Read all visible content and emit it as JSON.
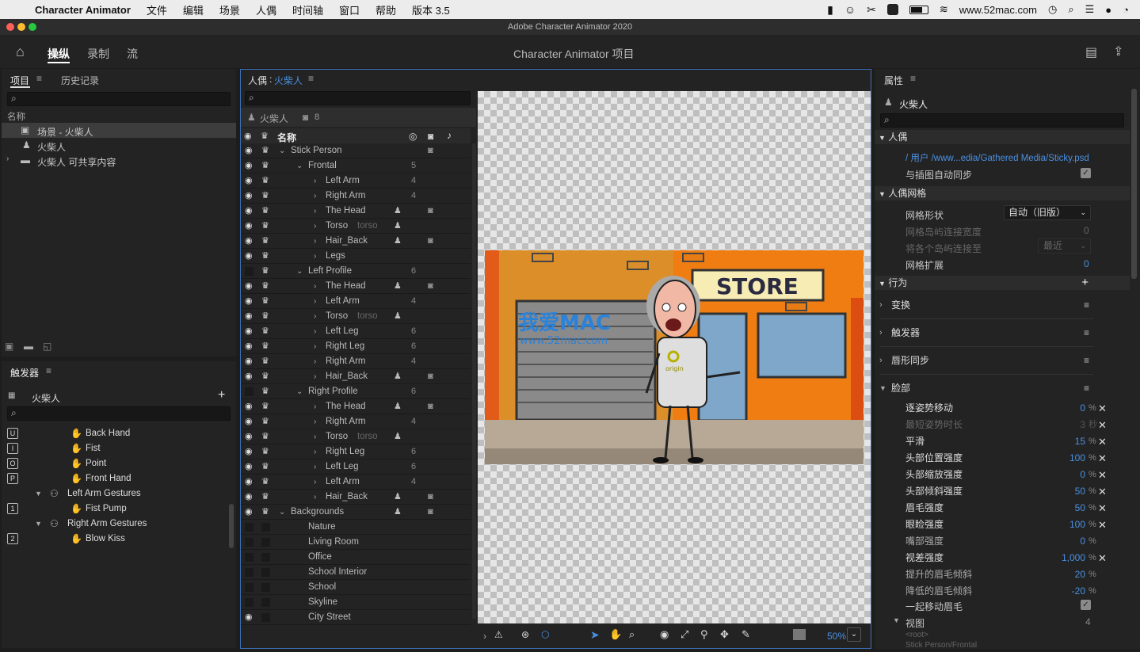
{
  "menubar": {
    "app_name": "Character Animator",
    "items": [
      "文件",
      "编辑",
      "场景",
      "人偶",
      "时间轴",
      "窗口",
      "帮助",
      "版本 3.5"
    ],
    "url": "www.52mac.com"
  },
  "window": {
    "title": "Adobe Character Animator 2020"
  },
  "header": {
    "workspaces": [
      "操纵",
      "录制",
      "流"
    ],
    "active_workspace": "操纵",
    "project_title": "Character Animator 项目"
  },
  "project_panel": {
    "tabs": [
      "项目",
      "历史记录"
    ],
    "column_name": "名称",
    "items": [
      {
        "label": "场景 - 火柴人",
        "icon": "scene-icon"
      },
      {
        "label": "火柴人",
        "icon": "puppet-icon"
      },
      {
        "label": "火柴人 可共享内容",
        "icon": "folder-icon"
      }
    ]
  },
  "trigger_panel": {
    "title": "触发器",
    "puppet": "火柴人",
    "rows": [
      {
        "key": "U",
        "label": "Back Hand",
        "indent": 2
      },
      {
        "key": "I",
        "label": "Fist",
        "indent": 2
      },
      {
        "key": "O",
        "label": "Point",
        "indent": 2
      },
      {
        "key": "P",
        "label": "Front Hand",
        "indent": 2
      },
      {
        "key": "",
        "label": "Left Arm Gestures",
        "indent": 1,
        "group": true
      },
      {
        "key": "1",
        "label": "Fist Pump",
        "indent": 2
      },
      {
        "key": "",
        "label": "Right Arm Gestures",
        "indent": 1,
        "group": true
      },
      {
        "key": "2",
        "label": "Blow Kiss",
        "indent": 2
      }
    ]
  },
  "puppet_panel": {
    "title": "人偶",
    "puppet_name": "火柴人",
    "header_name": "火柴人",
    "layer_count": "8",
    "column_name": "名称",
    "layers": [
      {
        "label": "Stick Person",
        "indent": 0,
        "open": true,
        "eye": true,
        "count": "",
        "tag": "",
        "cam": true
      },
      {
        "label": "Frontal",
        "indent": 1,
        "open": true,
        "eye": true,
        "count": "5"
      },
      {
        "label": "Left Arm",
        "indent": 2,
        "eye": true,
        "count": "4"
      },
      {
        "label": "Right Arm",
        "indent": 2,
        "eye": true,
        "count": "4"
      },
      {
        "label": "The Head",
        "indent": 2,
        "eye": true,
        "tag": true,
        "cam": true
      },
      {
        "label": "Torso",
        "sub": "torso",
        "indent": 2,
        "eye": true,
        "tag": true
      },
      {
        "label": "Hair_Back",
        "indent": 2,
        "eye": true,
        "tag": true,
        "cam": true
      },
      {
        "label": "Legs",
        "indent": 2,
        "eye": true
      },
      {
        "label": "Left Profile",
        "indent": 1,
        "open": true,
        "eye": false,
        "count": "6"
      },
      {
        "label": "The Head",
        "indent": 2,
        "eye": true,
        "tag": true,
        "cam": true
      },
      {
        "label": "Left Arm",
        "indent": 2,
        "eye": true,
        "count": "4"
      },
      {
        "label": "Torso",
        "sub": "torso",
        "indent": 2,
        "eye": true,
        "tag": true
      },
      {
        "label": "Left Leg",
        "indent": 2,
        "eye": true,
        "count": "6"
      },
      {
        "label": "Right Leg",
        "indent": 2,
        "eye": true,
        "count": "6"
      },
      {
        "label": "Right Arm",
        "indent": 2,
        "eye": true,
        "count": "4"
      },
      {
        "label": "Hair_Back",
        "indent": 2,
        "eye": true,
        "tag": true,
        "cam": true
      },
      {
        "label": "Right Profile",
        "indent": 1,
        "open": true,
        "eye": false,
        "count": "6"
      },
      {
        "label": "The Head",
        "indent": 2,
        "eye": true,
        "tag": true,
        "cam": true
      },
      {
        "label": "Right Arm",
        "indent": 2,
        "eye": true,
        "count": "4"
      },
      {
        "label": "Torso",
        "sub": "torso",
        "indent": 2,
        "eye": true,
        "tag": true
      },
      {
        "label": "Right Leg",
        "indent": 2,
        "eye": true,
        "count": "6"
      },
      {
        "label": "Left Leg",
        "indent": 2,
        "eye": true,
        "count": "6"
      },
      {
        "label": "Left Arm",
        "indent": 2,
        "eye": true,
        "count": "4"
      },
      {
        "label": "Hair_Back",
        "indent": 2,
        "eye": true,
        "tag": true,
        "cam": true
      },
      {
        "label": "Backgrounds",
        "indent": 0,
        "open": true,
        "eye": true,
        "tag": true,
        "cam": true
      },
      {
        "label": "Nature",
        "indent": 1,
        "eye": false,
        "leaf": true
      },
      {
        "label": "Living Room",
        "indent": 1,
        "eye": false,
        "leaf": true
      },
      {
        "label": "Office",
        "indent": 1,
        "eye": false,
        "leaf": true
      },
      {
        "label": "School Interior",
        "indent": 1,
        "eye": false,
        "leaf": true
      },
      {
        "label": "School",
        "indent": 1,
        "eye": false,
        "leaf": true
      },
      {
        "label": "Skyline",
        "indent": 1,
        "eye": false,
        "leaf": true
      },
      {
        "label": "City Street",
        "indent": 1,
        "eye": true,
        "leaf": true
      }
    ]
  },
  "canvas": {
    "store_sign": "STORE",
    "origin_label": "origin",
    "watermark_cn": "我爱MAC",
    "watermark_url": "www.52mac.com",
    "zoom": "50%"
  },
  "properties_panel": {
    "title": "属性",
    "puppet_name": "火柴人",
    "sections": {
      "puppet": "人偶",
      "mesh": "人偶网格",
      "behaviors": "行为"
    },
    "path": "/ 用户 /www...edia/Gathered Media/Sticky.psd",
    "auto_sync": "与插图自动同步",
    "mesh_shape_label": "网格形状",
    "mesh_shape_value": "自动（旧版）",
    "island_width_label": "网格岛屿连接宽度",
    "island_width_value": "0",
    "island_connect_label": "将各个岛屿连接至",
    "island_connect_value": "最近",
    "mesh_expand_label": "网格扩展",
    "mesh_expand_value": "0",
    "behavior_items": [
      "变换",
      "触发器",
      "唇形同步",
      "脸部"
    ],
    "face_params": [
      {
        "label": "逐姿势移动",
        "value": "0",
        "unit": "%",
        "x": true,
        "bright": true
      },
      {
        "label": "最短姿势时长",
        "value": "3",
        "unit": "秒",
        "x": true,
        "bright": false
      },
      {
        "label": "平滑",
        "value": "15",
        "unit": "%",
        "x": true,
        "bright": true
      },
      {
        "label": "头部位置强度",
        "value": "100",
        "unit": "%",
        "x": true,
        "bright": true
      },
      {
        "label": "头部缩放强度",
        "value": "0",
        "unit": "%",
        "x": true,
        "bright": true
      },
      {
        "label": "头部倾斜强度",
        "value": "50",
        "unit": "%",
        "x": true,
        "bright": true
      },
      {
        "label": "眉毛强度",
        "value": "50",
        "unit": "%",
        "x": true,
        "bright": true
      },
      {
        "label": "眼睑强度",
        "value": "100",
        "unit": "%",
        "x": true,
        "bright": true
      },
      {
        "label": "嘴部强度",
        "value": "0",
        "unit": "%",
        "x": false,
        "bright": false
      },
      {
        "label": "视差强度",
        "value": "1,000",
        "unit": "%",
        "x": true,
        "bright": true
      },
      {
        "label": "提升的眉毛倾斜",
        "value": "20",
        "unit": "%",
        "x": false,
        "bright": false
      },
      {
        "label": "降低的眉毛倾斜",
        "value": "-20",
        "unit": "%",
        "x": false,
        "bright": false
      }
    ],
    "move_eyebrows_together": "一起移动眉毛",
    "view_label": "视图",
    "view_count": "4",
    "view_root": "<root>",
    "view_path": "Stick Person/Frontal"
  },
  "colors": {
    "accent": "#4a90e2",
    "panel": "#232323",
    "bg": "#1d1d1d"
  }
}
